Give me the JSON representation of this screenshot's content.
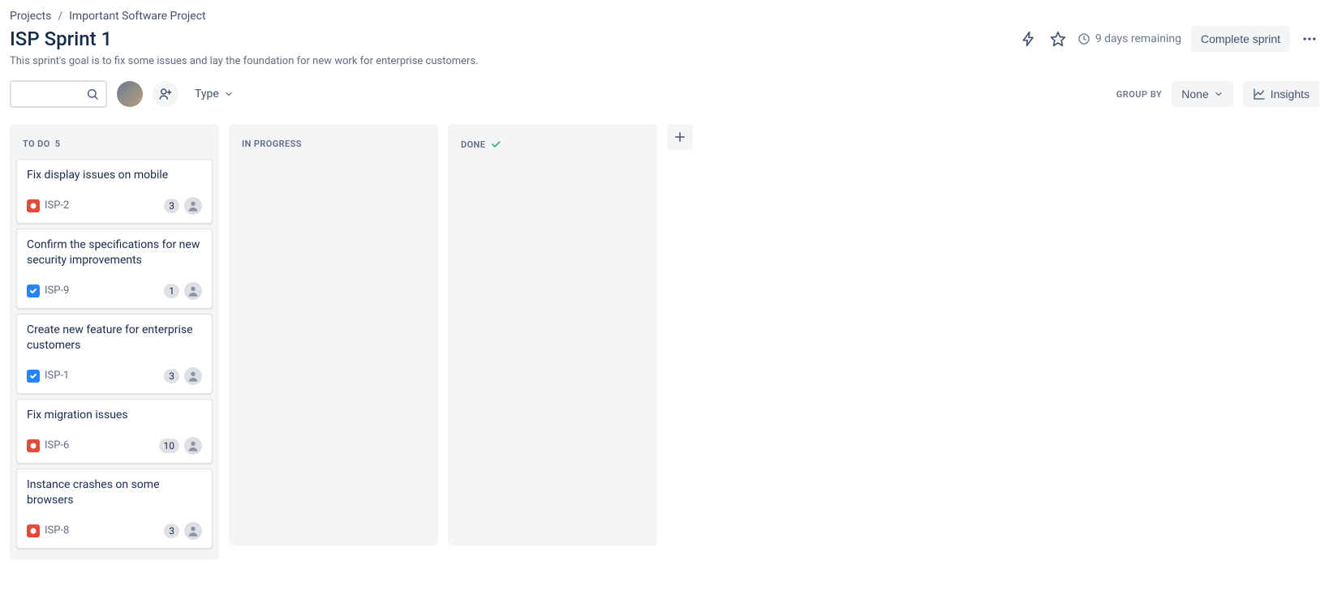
{
  "breadcrumb": {
    "root": "Projects",
    "project": "Important Software Project"
  },
  "header": {
    "title": "ISP Sprint 1",
    "subtitle": "This sprint's goal is to fix some issues and lay the foundation for new work for enterprise customers.",
    "remaining": "9 days remaining",
    "complete_label": "Complete sprint"
  },
  "toolbar": {
    "type_label": "Type",
    "groupby_label": "GROUP BY",
    "groupby_value": "None",
    "insights_label": "Insights"
  },
  "columns": [
    {
      "name": "TO DO",
      "count": "5",
      "done_check": false
    },
    {
      "name": "IN PROGRESS",
      "count": "",
      "done_check": false
    },
    {
      "name": "DONE",
      "count": "",
      "done_check": true
    }
  ],
  "cards": [
    {
      "title": "Fix display issues on mobile",
      "key": "ISP-2",
      "type": "bug",
      "points": "3"
    },
    {
      "title": "Confirm the specifications for new security improvements",
      "key": "ISP-9",
      "type": "task",
      "points": "1"
    },
    {
      "title": "Create new feature for enterprise customers",
      "key": "ISP-1",
      "type": "task",
      "points": "3"
    },
    {
      "title": "Fix migration issues",
      "key": "ISP-6",
      "type": "bug",
      "points": "10"
    },
    {
      "title": "Instance crashes on some browsers",
      "key": "ISP-8",
      "type": "bug",
      "points": "3"
    }
  ]
}
